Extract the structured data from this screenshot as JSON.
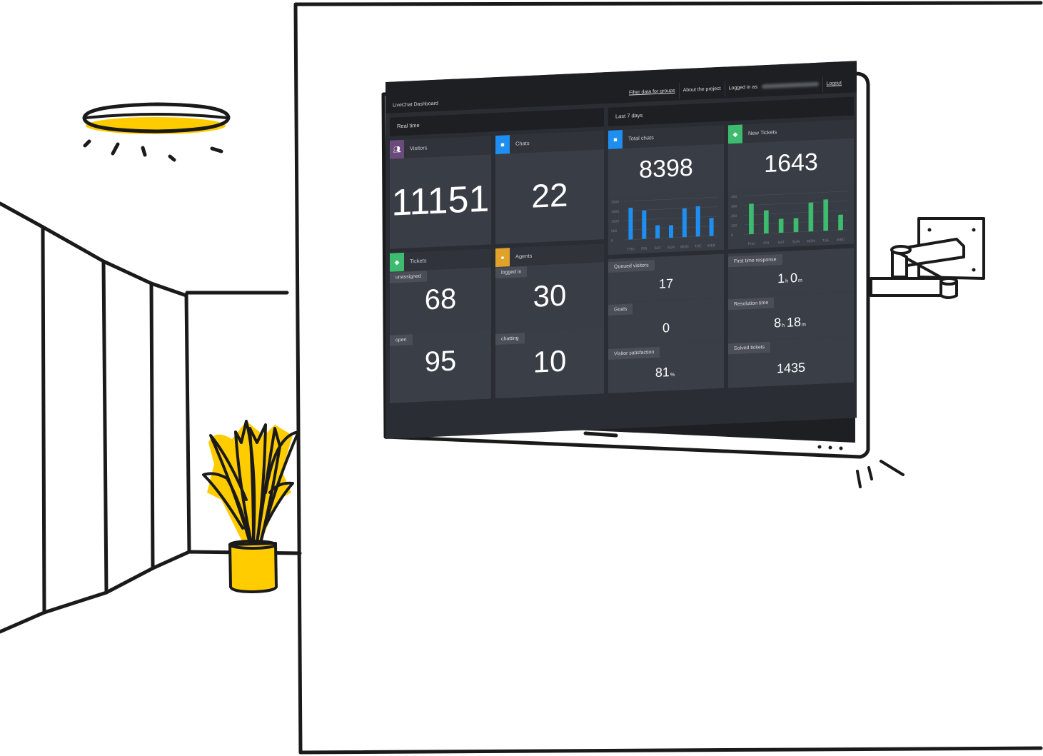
{
  "illustration": {
    "colors": {
      "line": "#1a1a1a",
      "accent_yellow": "#ffcc00",
      "tv_bezel": "#ffffff"
    },
    "objects": [
      "ceiling-lamp",
      "wall-panels",
      "potted-plant",
      "wall-mount-arm",
      "tv-screen"
    ]
  },
  "dashboard": {
    "app_title": "LiveChat Dashboard",
    "topnav": {
      "filter_link": "Filter data for groups",
      "about_link": "About the project",
      "logged_in_label": "Logged in as:",
      "logout_link": "Logout"
    },
    "colors": {
      "bg": "#2a2d33",
      "topbar": "#1d1f23",
      "tile": "#393d45",
      "visitors_accent": "#6b4a7c",
      "chats_accent": "#1e8ef0",
      "tickets_accent": "#3dbb6e",
      "agents_accent": "#e0a22a",
      "bar_blue": "#1e8ef0",
      "bar_green": "#3dbb6e"
    },
    "realtime": {
      "header": "Real time",
      "visitors": {
        "title": "Visitors",
        "icon": "people-icon",
        "value": "11151"
      },
      "chats": {
        "title": "Chats",
        "icon": "chat-bubble-icon",
        "value": "22"
      },
      "tickets": {
        "title": "Tickets",
        "icon": "tag-icon",
        "unassigned_label": "unassigned",
        "unassigned_value": "68",
        "open_label": "open",
        "open_value": "95"
      },
      "agents": {
        "title": "Agents",
        "icon": "agent-icon",
        "logged_in_label": "logged in",
        "logged_in_value": "30",
        "chatting_label": "chatting",
        "chatting_value": "10"
      }
    },
    "last7": {
      "header": "Last 7 days",
      "total_chats": {
        "title": "Total chats",
        "icon": "chat-bubble-icon",
        "value": "8398"
      },
      "new_tickets": {
        "title": "New Tickets",
        "icon": "tag-icon",
        "value": "1643"
      },
      "queued_visitors": {
        "label": "Queued visitors",
        "value": "17"
      },
      "goals": {
        "label": "Goals",
        "value": "0"
      },
      "visitor_satisfaction": {
        "label": "Visitor satisfaction",
        "value": "81",
        "unit": "%"
      },
      "first_time_response": {
        "label": "First time response",
        "hours": "1",
        "h_unit": "h",
        "minutes": "0",
        "m_unit": "m"
      },
      "resolution_time": {
        "label": "Resolution time",
        "hours": "8",
        "h_unit": "h",
        "minutes": "18",
        "m_unit": "m"
      },
      "solved_tickets": {
        "label": "Solved tickets",
        "value": "1435"
      }
    }
  },
  "chart_data": [
    {
      "type": "bar",
      "title": "Total chats",
      "categories": [
        "THU",
        "FRI",
        "SAT",
        "SUN",
        "MON",
        "TUE",
        "WED"
      ],
      "values": [
        1650,
        1480,
        680,
        650,
        1490,
        1570,
        930
      ],
      "yticks": [
        "0",
        "500",
        "1000",
        "1500",
        "2000"
      ],
      "ylim": [
        0,
        2000
      ],
      "grid": true,
      "color": "#1e8ef0"
    },
    {
      "type": "bar",
      "title": "New Tickets",
      "categories": [
        "THU",
        "FRI",
        "SAT",
        "SUN",
        "MON",
        "TUE",
        "WED"
      ],
      "values": [
        315,
        240,
        145,
        145,
        300,
        325,
        160
      ],
      "yticks": [
        "0",
        "100",
        "200",
        "300",
        "400"
      ],
      "ylim": [
        0,
        400
      ],
      "grid": true,
      "color": "#3dbb6e"
    }
  ]
}
